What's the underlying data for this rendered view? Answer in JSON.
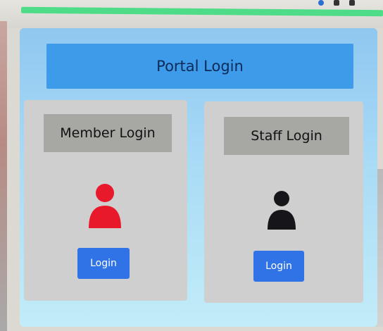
{
  "portal": {
    "title": "Portal Login"
  },
  "member": {
    "title": "Member Login",
    "button_label": "Login",
    "icon": "user-icon",
    "icon_color": "#e8192b"
  },
  "staff": {
    "title": "Staff Login",
    "button_label": "Login",
    "icon": "user-icon",
    "icon_color": "#16161a"
  },
  "colors": {
    "accent": "#2f73e6",
    "header": "#3d9be9",
    "progress_bar": "#4fdc88"
  }
}
